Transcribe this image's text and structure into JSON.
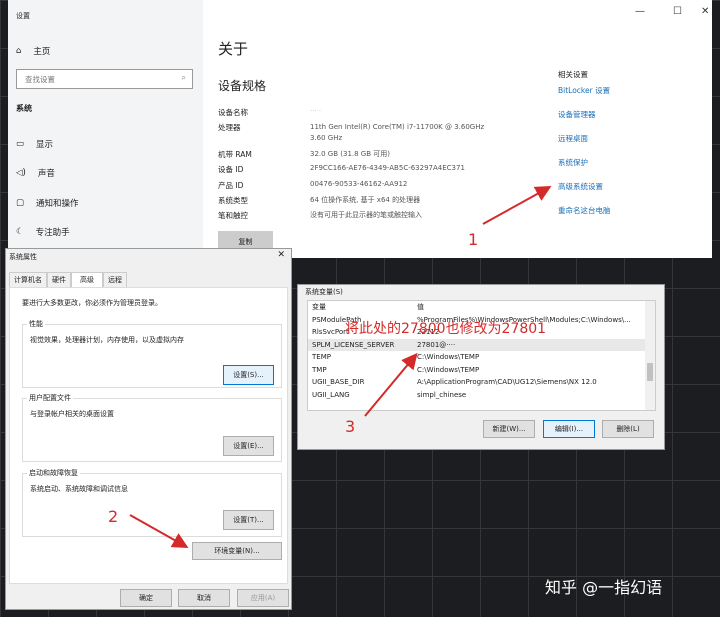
{
  "settings": {
    "window_title": "设置",
    "minimize": "—",
    "maximize": "☐",
    "close": "✕",
    "home": "主页",
    "search_placeholder": "查找设置",
    "section": "系统",
    "nav": [
      {
        "label": "显示",
        "icon": "monitor-icon"
      },
      {
        "label": "声音",
        "icon": "speaker-icon"
      },
      {
        "label": "通知和操作",
        "icon": "notification-icon"
      },
      {
        "label": "专注助手",
        "icon": "moon-icon"
      }
    ],
    "page_title": "关于",
    "specs_title": "设备规格",
    "specs": [
      {
        "label": "设备名称",
        "value": "··· ·"
      },
      {
        "label": "处理器",
        "value": "11th Gen Intel(R) Core(TM) i7-11700K @ 3.60GHz",
        "value2": "3.60 GHz"
      },
      {
        "label": "机带 RAM",
        "value": "32.0 GB (31.8 GB 可用)"
      },
      {
        "label": "设备 ID",
        "value": "2F9CC166-AE76-4349-AB5C-63297A4EC371"
      },
      {
        "label": "产品 ID",
        "value": "00476-90533-46162-AA912"
      },
      {
        "label": "系统类型",
        "value": "64 位操作系统, 基于 x64 的处理器"
      },
      {
        "label": "笔和触控",
        "value": "没有可用于此显示器的笔或触控输入"
      }
    ],
    "copy": "复制",
    "related_title": "相关设置",
    "related": [
      "BitLocker 设置",
      "设备管理器",
      "远程桌面",
      "系统保护",
      "高级系统设置",
      "重命名这台电脑"
    ]
  },
  "sysprop": {
    "title": "系统属性",
    "close": "✕",
    "tabs": [
      "计算机名",
      "硬件",
      "高级",
      "远程"
    ],
    "admin_note": "要进行大多数更改，你必须作为管理员登录。",
    "groups": [
      {
        "title": "性能",
        "desc": "视觉效果，处理器计划，内存使用，以及虚拟内存",
        "button": "设置(S)..."
      },
      {
        "title": "用户配置文件",
        "desc": "与登录帐户相关的桌面设置",
        "button": "设置(E)..."
      },
      {
        "title": "启动和故障恢复",
        "desc": "系统启动、系统故障和调试信息",
        "button": "设置(T)..."
      }
    ],
    "env_button": "环境变量(N)...",
    "ok": "确定",
    "cancel": "取消",
    "apply": "应用(A)"
  },
  "envvars": {
    "title": "系统变量(S)",
    "col_var": "变量",
    "col_val": "值",
    "rows": [
      {
        "var": "PSModulePath",
        "val": "%ProgramFiles%\\WindowsPowerShell\\Modules;C:\\Windows\\..."
      },
      {
        "var": "RlsSvcPort",
        "val": "22112"
      },
      {
        "var": "SPLM_LICENSE_SERVER",
        "val": "27801@····"
      },
      {
        "var": "TEMP",
        "val": "C:\\Windows\\TEMP"
      },
      {
        "var": "TMP",
        "val": "C:\\Windows\\TEMP"
      },
      {
        "var": "UGII_BASE_DIR",
        "val": "A:\\ApplicationProgram\\CAD\\UG12\\Siemens\\NX 12.0"
      },
      {
        "var": "UGII_LANG",
        "val": "simpl_chinese"
      }
    ],
    "new": "新建(W)...",
    "edit": "编辑(I)...",
    "delete": "删除(L)"
  },
  "annotations": {
    "step1": "1",
    "step2": "2",
    "step3": "3",
    "note": "将此处的27800也修改为27801",
    "accent": "#d42a2a"
  },
  "watermark": "知乎 @一指幻语"
}
